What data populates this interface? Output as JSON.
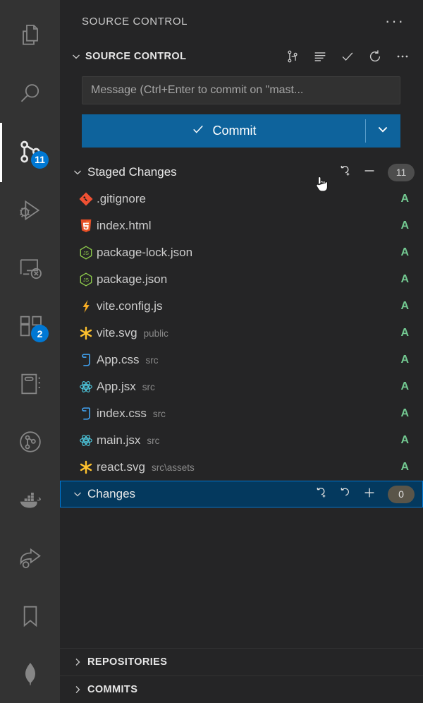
{
  "activity_bar": {
    "items": [
      {
        "name": "explorer",
        "icon": "files-icon",
        "badge": null,
        "active": false
      },
      {
        "name": "search",
        "icon": "search-icon",
        "badge": null,
        "active": false
      },
      {
        "name": "source-control",
        "icon": "source-control-icon",
        "badge": "11",
        "active": true
      },
      {
        "name": "run-and-debug",
        "icon": "debug-icon",
        "badge": null,
        "active": false
      },
      {
        "name": "remote-explorer",
        "icon": "remote-explorer-icon",
        "badge": null,
        "active": false
      },
      {
        "name": "extensions",
        "icon": "extensions-icon",
        "badge": "2",
        "active": false
      },
      {
        "name": "notebook",
        "icon": "notebook-icon",
        "badge": null,
        "active": false
      },
      {
        "name": "git-graph",
        "icon": "git-graph-icon",
        "badge": null,
        "active": false
      },
      {
        "name": "docker",
        "icon": "docker-whale-icon",
        "badge": null,
        "active": false
      },
      {
        "name": "share",
        "icon": "share-icon",
        "badge": null,
        "active": false
      },
      {
        "name": "bookmarks",
        "icon": "bookmark-icon",
        "badge": null,
        "active": false
      },
      {
        "name": "mongodb",
        "icon": "mongodb-leaf-icon",
        "badge": null,
        "active": false
      }
    ],
    "badge_color": "#0078d4"
  },
  "panel": {
    "title": "SOURCE CONTROL",
    "more_actions_label": "···"
  },
  "source_control_section": {
    "title": "SOURCE CONTROL",
    "expanded": true,
    "actions": [
      {
        "name": "view-changes-graph",
        "icon": "source-control-graph-icon"
      },
      {
        "name": "view-as-list",
        "icon": "list-flat-icon"
      },
      {
        "name": "commit",
        "icon": "check-icon"
      },
      {
        "name": "refresh",
        "icon": "refresh-icon"
      },
      {
        "name": "more-actions",
        "icon": "ellipsis-icon"
      }
    ]
  },
  "commit": {
    "message_value": "",
    "message_placeholder": "Message (Ctrl+Enter to commit on \"mast...",
    "button_label": "Commit",
    "button_color": "#0e639c",
    "dropdown_icon": "chevron-down-icon"
  },
  "groups": [
    {
      "label": "Staged Changes",
      "count": "11",
      "expanded": true,
      "selected": false,
      "actions": [
        {
          "name": "unstage-all-changes-restore",
          "icon": "discard-plus-icon"
        },
        {
          "name": "unstage-all-changes",
          "icon": "minus-icon"
        }
      ]
    },
    {
      "label": "Changes",
      "count": "0",
      "expanded": true,
      "selected": true,
      "actions": [
        {
          "name": "stash-changes",
          "icon": "discard-plus-icon"
        },
        {
          "name": "discard-all-changes",
          "icon": "discard-icon"
        },
        {
          "name": "stage-all-changes",
          "icon": "plus-icon"
        }
      ]
    }
  ],
  "staged_files": [
    {
      "name": ".gitignore",
      "dir": "",
      "status": "A",
      "icon": "git-icon"
    },
    {
      "name": "index.html",
      "dir": "",
      "status": "A",
      "icon": "html5-icon"
    },
    {
      "name": "package-lock.json",
      "dir": "",
      "status": "A",
      "icon": "nodejs-icon"
    },
    {
      "name": "package.json",
      "dir": "",
      "status": "A",
      "icon": "nodejs-icon"
    },
    {
      "name": "vite.config.js",
      "dir": "",
      "status": "A",
      "icon": "vite-bolt-icon"
    },
    {
      "name": "vite.svg",
      "dir": "public",
      "status": "A",
      "icon": "svg-asterisk-icon"
    },
    {
      "name": "App.css",
      "dir": "src",
      "status": "A",
      "icon": "css3-icon"
    },
    {
      "name": "App.jsx",
      "dir": "src",
      "status": "A",
      "icon": "react-icon"
    },
    {
      "name": "index.css",
      "dir": "src",
      "status": "A",
      "icon": "css3-icon"
    },
    {
      "name": "main.jsx",
      "dir": "src",
      "status": "A",
      "icon": "react-icon"
    },
    {
      "name": "react.svg",
      "dir": "src\\assets",
      "status": "A",
      "icon": "svg-asterisk-icon"
    }
  ],
  "changes_files": [],
  "bottom_sections": [
    {
      "label": "REPOSITORIES",
      "expanded": false
    },
    {
      "label": "COMMITS",
      "expanded": false
    }
  ],
  "colors": {
    "activity_bar_bg": "#333333",
    "panel_bg": "#252526",
    "selection_bg": "#04395e",
    "selection_border": "#0078d4",
    "status_added": "#73c991",
    "text_primary": "#cccccc"
  }
}
